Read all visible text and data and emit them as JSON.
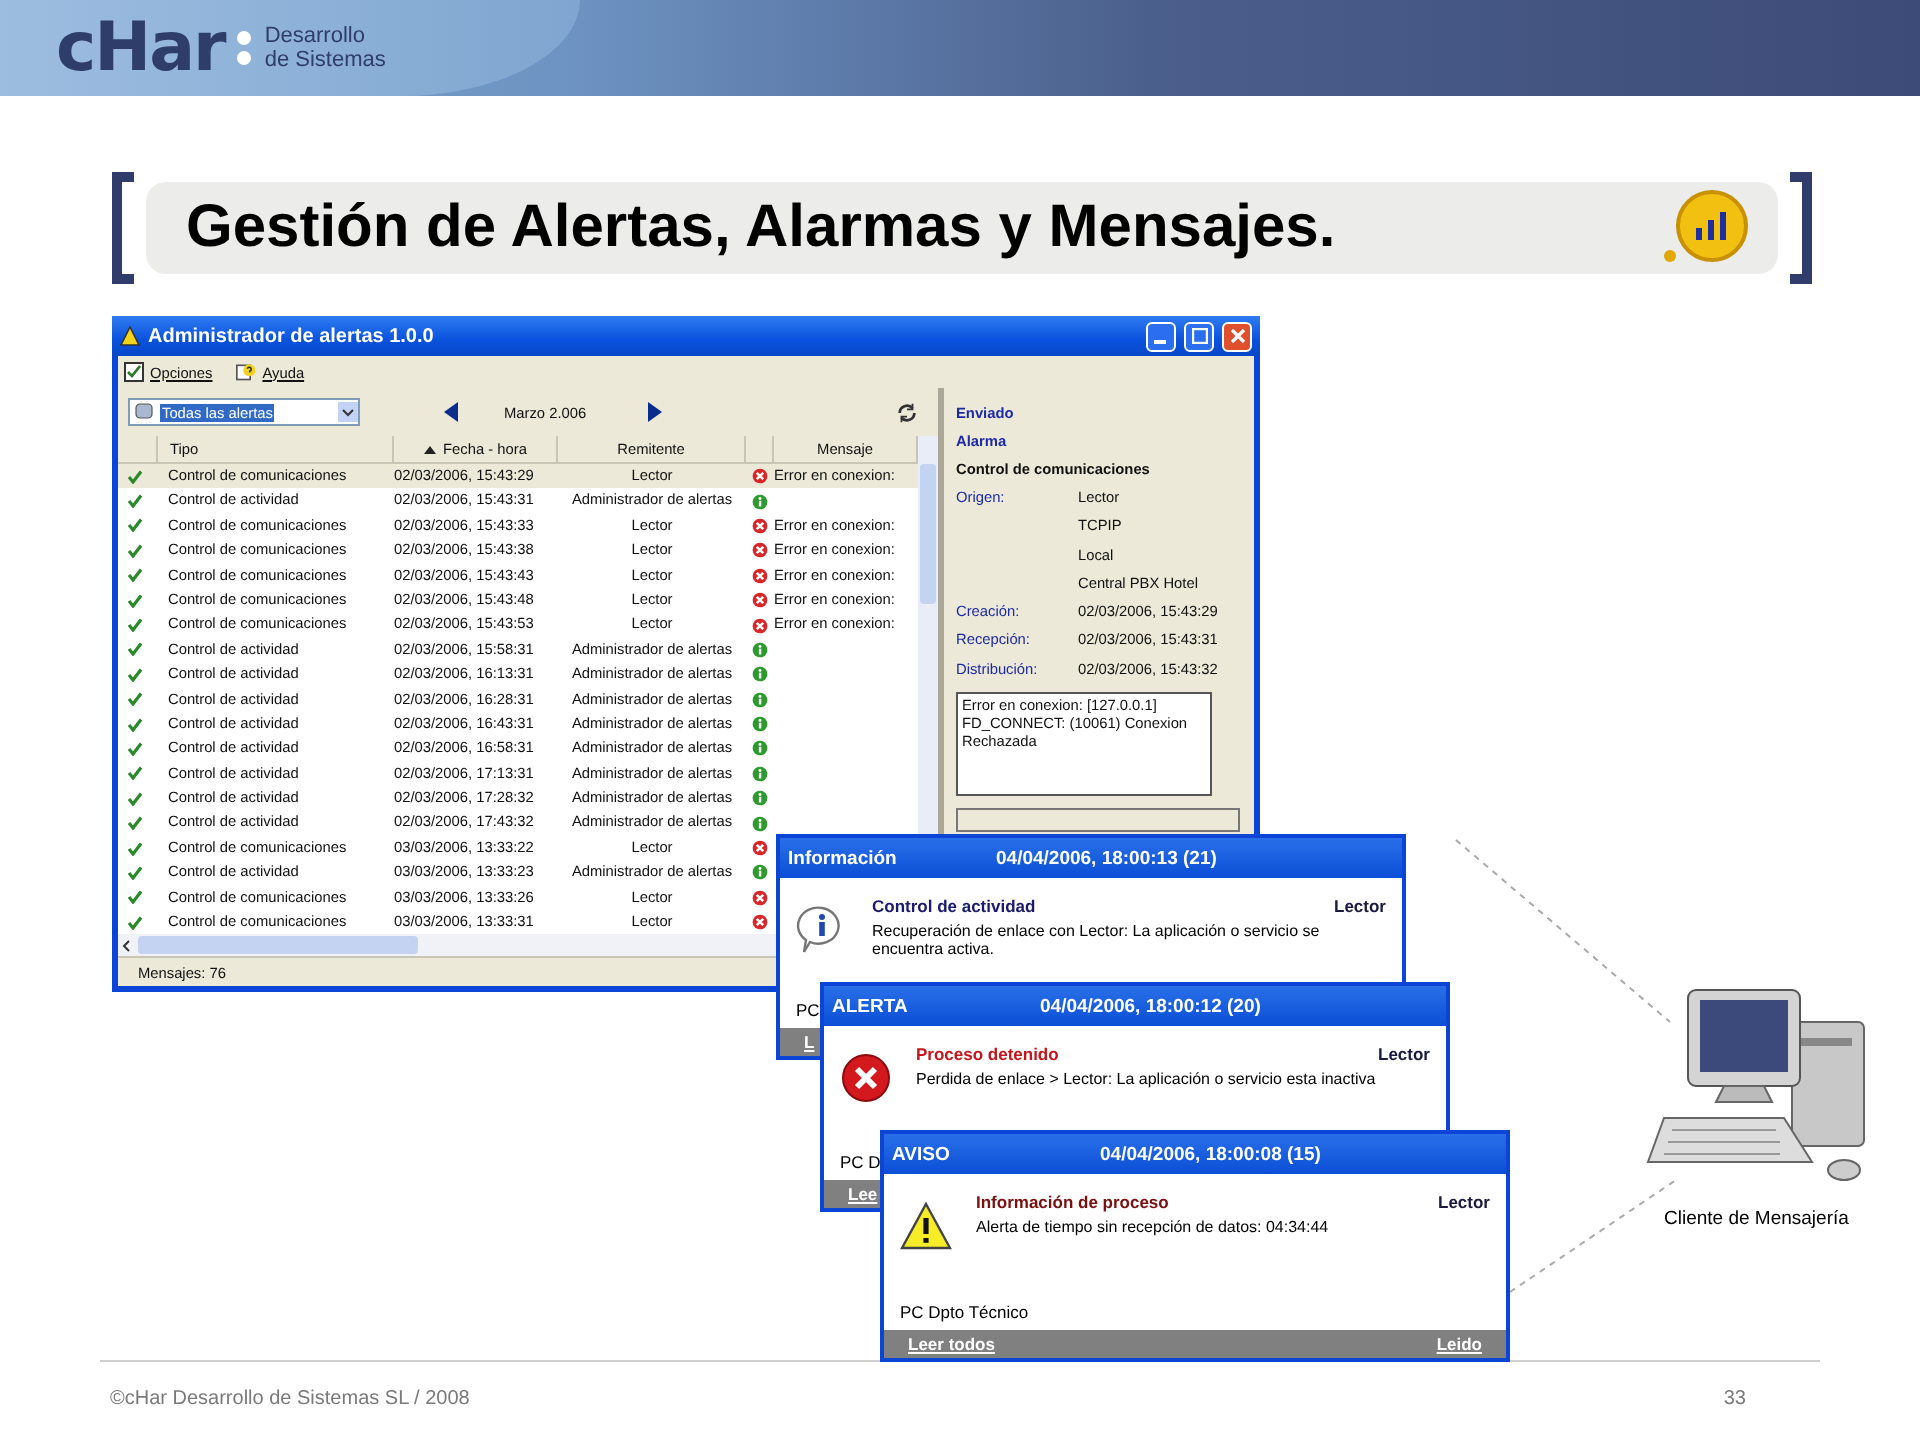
{
  "header": {
    "logo": "cHar",
    "tagline": [
      "Desarrollo",
      "de Sistemas"
    ]
  },
  "slide_title": "Gestión de Alertas, Alarmas y Mensajes.",
  "main_window": {
    "title": "Administrador de alertas 1.0.0",
    "menu": [
      {
        "label": "Opciones",
        "kind": "check"
      },
      {
        "label": "Ayuda",
        "kind": "help"
      }
    ],
    "filter": "Todas las alertas",
    "month": "Marzo 2.006",
    "columns": [
      "Tipo",
      "Fecha - hora",
      "Remitente",
      "Mensaje"
    ],
    "rows": [
      {
        "checked": true,
        "selected": true,
        "type": "Control de comunicaciones",
        "datetime": "02/03/2006, 15:43:29",
        "sender": "Lector",
        "kind": "error",
        "message": "Error en conexion:"
      },
      {
        "checked": true,
        "selected": false,
        "type": "Control de actividad",
        "datetime": "02/03/2006, 15:43:31",
        "sender": "Administrador de alertas",
        "kind": "info"
      },
      {
        "checked": true,
        "selected": false,
        "type": "Control de comunicaciones",
        "datetime": "02/03/2006, 15:43:33",
        "sender": "Lector",
        "kind": "error",
        "message": "Error en conexion:"
      },
      {
        "checked": true,
        "selected": false,
        "type": "Control de comunicaciones",
        "datetime": "02/03/2006, 15:43:38",
        "sender": "Lector",
        "kind": "error",
        "message": "Error en conexion:"
      },
      {
        "checked": true,
        "selected": false,
        "type": "Control de comunicaciones",
        "datetime": "02/03/2006, 15:43:43",
        "sender": "Lector",
        "kind": "error",
        "message": "Error en conexion:"
      },
      {
        "checked": true,
        "selected": false,
        "type": "Control de comunicaciones",
        "datetime": "02/03/2006, 15:43:48",
        "sender": "Lector",
        "kind": "error",
        "message": "Error en conexion:"
      },
      {
        "checked": true,
        "selected": false,
        "type": "Control de comunicaciones",
        "datetime": "02/03/2006, 15:43:53",
        "sender": "Lector",
        "kind": "error",
        "message": "Error en conexion:"
      },
      {
        "checked": true,
        "selected": false,
        "type": "Control de actividad",
        "datetime": "02/03/2006, 15:58:31",
        "sender": "Administrador de alertas",
        "kind": "info"
      },
      {
        "checked": true,
        "selected": false,
        "type": "Control de actividad",
        "datetime": "02/03/2006, 16:13:31",
        "sender": "Administrador de alertas",
        "kind": "info"
      },
      {
        "checked": true,
        "selected": false,
        "type": "Control de actividad",
        "datetime": "02/03/2006, 16:28:31",
        "sender": "Administrador de alertas",
        "kind": "info"
      },
      {
        "checked": true,
        "selected": false,
        "type": "Control de actividad",
        "datetime": "02/03/2006, 16:43:31",
        "sender": "Administrador de alertas",
        "kind": "info"
      },
      {
        "checked": true,
        "selected": false,
        "type": "Control de actividad",
        "datetime": "02/03/2006, 16:58:31",
        "sender": "Administrador de alertas",
        "kind": "info"
      },
      {
        "checked": true,
        "selected": false,
        "type": "Control de actividad",
        "datetime": "02/03/2006, 17:13:31",
        "sender": "Administrador de alertas",
        "kind": "info"
      },
      {
        "checked": true,
        "selected": false,
        "type": "Control de actividad",
        "datetime": "02/03/2006, 17:28:32",
        "sender": "Administrador de alertas",
        "kind": "info"
      },
      {
        "checked": true,
        "selected": false,
        "type": "Control de actividad",
        "datetime": "02/03/2006, 17:43:32",
        "sender": "Administrador de alertas",
        "kind": "info"
      },
      {
        "checked": true,
        "selected": false,
        "type": "Control de comunicaciones",
        "datetime": "03/03/2006, 13:33:22",
        "sender": "Lector",
        "kind": "error"
      },
      {
        "checked": true,
        "selected": false,
        "type": "Control de actividad",
        "datetime": "03/03/2006, 13:33:23",
        "sender": "Administrador de alertas",
        "kind": "info"
      },
      {
        "checked": true,
        "selected": false,
        "type": "Control de comunicaciones",
        "datetime": "03/03/2006, 13:33:26",
        "sender": "Lector",
        "kind": "error"
      },
      {
        "checked": true,
        "selected": false,
        "type": "Control de comunicaciones",
        "datetime": "03/03/2006, 13:33:31",
        "sender": "Lector",
        "kind": "error"
      }
    ],
    "status": "Mensajes: 76",
    "detail": {
      "state": "Enviado",
      "level": "Alarma",
      "type": "Control de comunicaciones",
      "fields": [
        {
          "label": "Origen:",
          "value": "Lector"
        },
        {
          "value": "TCPIP"
        },
        {
          "value": "Local"
        },
        {
          "value": "Central PBX Hotel"
        },
        {
          "label": "Creación:",
          "value": "02/03/2006, 15:43:29"
        },
        {
          "label": "Recepción:",
          "value": "02/03/2006, 15:43:31"
        },
        {
          "label": "Distribución:",
          "value": "02/03/2006, 15:43:32"
        }
      ],
      "text": "Error en conexion: [127.0.0.1]\nFD_CONNECT: (10061) Conexion\nRechazada"
    }
  },
  "popups": [
    {
      "kind": "info",
      "title": "Información",
      "timestamp": "04/04/2006, 18:00:13 (21)",
      "subject": "Control de actividad",
      "sender": "Lector",
      "message": "Recuperación de enlace con Lector: La aplicación o servicio se encuentra activa.",
      "computer": "PC",
      "read_all": "L"
    },
    {
      "kind": "error",
      "title": "ALERTA",
      "timestamp": "04/04/2006, 18:00:12 (20)",
      "subject": "Proceso detenido",
      "sender": "Lector",
      "message": "Perdida de enlace > Lector: La aplicación o servicio esta inactiva",
      "computer": "PC D",
      "read_all": "Lee"
    },
    {
      "kind": "warning",
      "title": "AVISO",
      "timestamp": "04/04/2006, 18:00:08 (15)",
      "subject": "Información de proceso",
      "sender": "Lector",
      "message": "Alerta de tiempo sin recepción de datos: 04:34:44",
      "computer": "PC Dpto Técnico",
      "read_all": "Leer todos",
      "read": "Leido"
    }
  ],
  "client_label": "Cliente de Mensajería",
  "footer": {
    "copyright": "©cHar Desarrollo de Sistemas SL / 2008",
    "page": "33"
  }
}
